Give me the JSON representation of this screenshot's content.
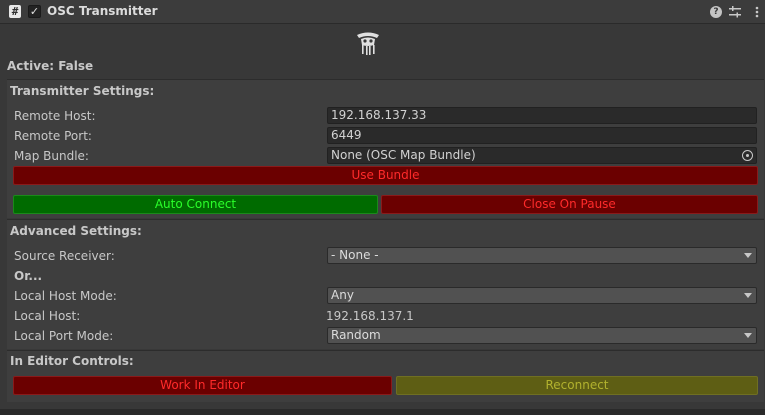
{
  "header": {
    "title": "OSC Transmitter",
    "enabled_check": "✓",
    "script_icon_glyph": "#",
    "help_glyph": "?"
  },
  "status": {
    "active_label": "Active: False"
  },
  "transmitter": {
    "heading": "Transmitter Settings:",
    "remote_host_label": "Remote Host:",
    "remote_host_value": "192.168.137.33",
    "remote_port_label": "Remote Port:",
    "remote_port_value": "6449",
    "map_bundle_label": "Map Bundle:",
    "map_bundle_value": "None (OSC Map Bundle)",
    "use_bundle_label": "Use Bundle",
    "auto_connect_label": "Auto Connect",
    "close_on_pause_label": "Close On Pause"
  },
  "advanced": {
    "heading": "Advanced Settings:",
    "source_receiver_label": "Source Receiver:",
    "source_receiver_value": "- None -",
    "or_label": "Or...",
    "local_host_mode_label": "Local Host Mode:",
    "local_host_mode_value": "Any",
    "local_host_label": "Local Host:",
    "local_host_value": "192.168.137.1",
    "local_port_mode_label": "Local Port Mode:",
    "local_port_mode_value": "Random"
  },
  "editor": {
    "heading": "In Editor Controls:",
    "work_in_editor_label": "Work In Editor",
    "reconnect_label": "Reconnect"
  },
  "colors": {
    "panel_bg": "#383838",
    "button_red": "#6b0000",
    "button_red_text": "#ff2a2a",
    "button_green": "#006b00",
    "button_green_text": "#2aff2a",
    "button_disabled_yellow": "#5e5e14",
    "button_disabled_yellow_text": "#b2b22e"
  }
}
